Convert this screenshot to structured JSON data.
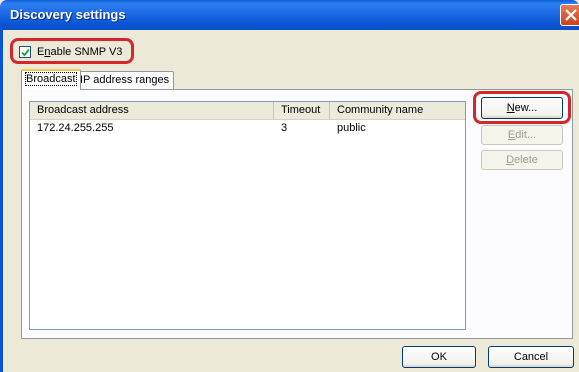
{
  "window": {
    "title": "Discovery settings"
  },
  "enable_snmp": {
    "label": "Enable SNMP V3",
    "checked": true
  },
  "tabs": [
    {
      "label": "Broadcast",
      "active": true
    },
    {
      "label": "IP address ranges",
      "active": false
    }
  ],
  "list": {
    "columns": [
      "Broadcast address",
      "Timeout",
      "Community name"
    ],
    "rows": [
      {
        "address": "172.24.255.255",
        "timeout": "3",
        "community": "public"
      }
    ]
  },
  "buttons": {
    "new": "New...",
    "edit": "Edit...",
    "delete": "Delete",
    "ok": "OK",
    "cancel": "Cancel"
  },
  "colors": {
    "titlebar": "#0b55d4",
    "highlight": "#d4262b",
    "dialog_bg": "#ece9d8"
  }
}
